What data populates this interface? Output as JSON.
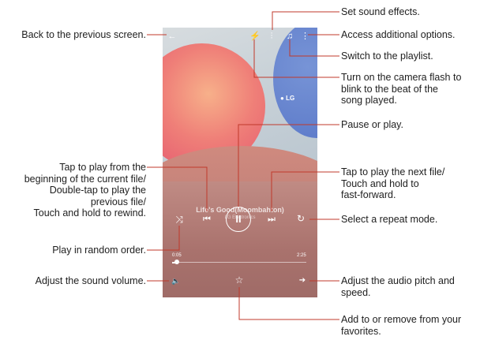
{
  "callouts": {
    "set_sound_effects": "Set sound effects.",
    "back": "Back to the previous screen.",
    "options": "Access additional options.",
    "playlist": "Switch to the playlist.",
    "flash": [
      "Turn on the camera flash to",
      "blink to the beat of the",
      "song played."
    ],
    "pause_play": "Pause or play.",
    "previous": [
      "Tap to play from the",
      "beginning of the current file/",
      "Double-tap to play the",
      "previous file/",
      "Touch and hold to rewind."
    ],
    "next": [
      "Tap to play the next file/",
      "Touch and hold to",
      "fast-forward."
    ],
    "repeat": "Select a repeat mode.",
    "shuffle": "Play in random order.",
    "volume": "Adjust the sound volume.",
    "pitch": [
      "Adjust the audio pitch and",
      "speed."
    ],
    "favorite": [
      "Add to or remove from your",
      "favorites."
    ]
  },
  "player": {
    "song_title": "Life's Good(Moombahton)",
    "artist": "LG Electronics",
    "elapsed": "0:05",
    "duration": "2:25",
    "progress_fraction": 0.035,
    "logo_text": "LG"
  },
  "icons": {
    "back": "←",
    "flash": "⚡",
    "sound_effects": "⫶",
    "playlist": "♫",
    "options": "⋮",
    "shuffle": "⤨",
    "previous": "⏮",
    "pause": "II",
    "next": "⏭",
    "repeat": "↻",
    "volume": "🔈",
    "favorite": "☆",
    "pitch": "➔"
  },
  "colors": {
    "callout_line": "#c0392b"
  }
}
